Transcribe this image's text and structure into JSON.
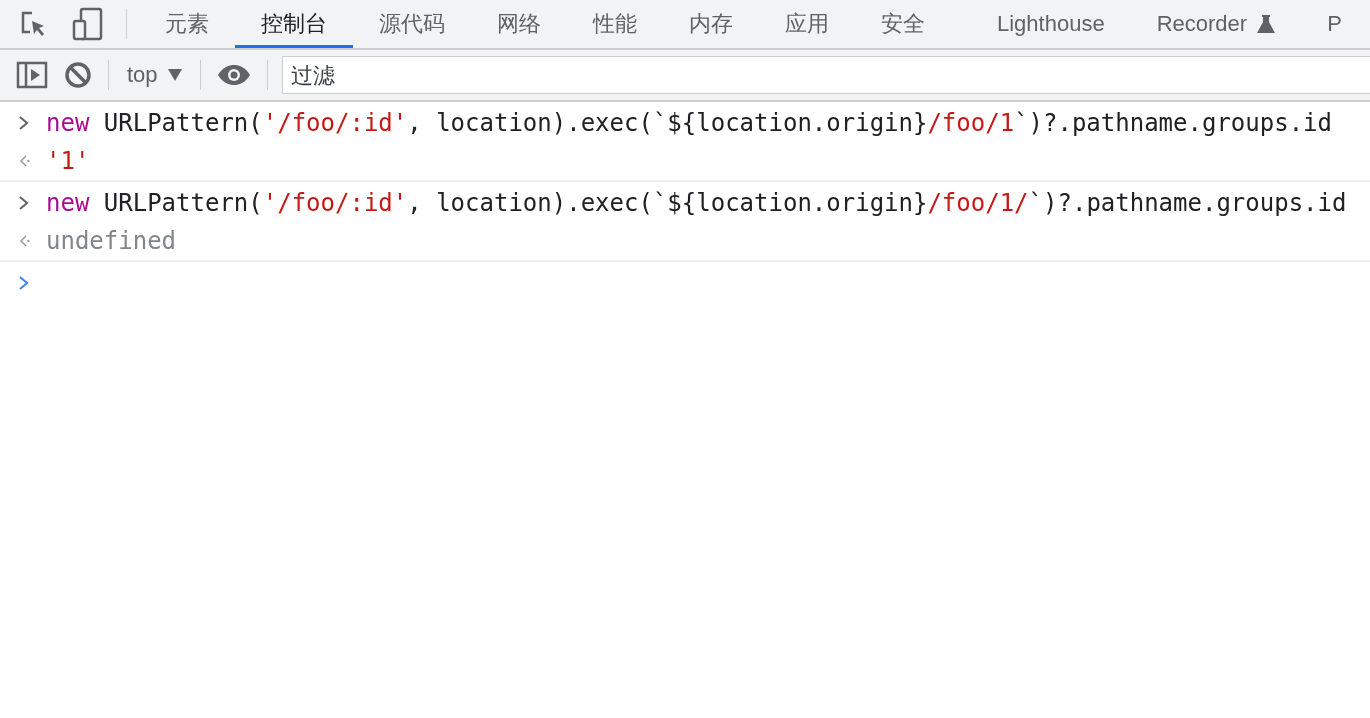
{
  "tabs": [
    {
      "label": "元素",
      "selected": false
    },
    {
      "label": "控制台",
      "selected": true
    },
    {
      "label": "源代码",
      "selected": false
    },
    {
      "label": "网络",
      "selected": false
    },
    {
      "label": "性能",
      "selected": false
    },
    {
      "label": "内存",
      "selected": false
    },
    {
      "label": "应用",
      "selected": false
    },
    {
      "label": "安全",
      "selected": false
    },
    {
      "label": "Lighthouse",
      "selected": false
    },
    {
      "label": "Recorder",
      "selected": false,
      "experimental": true
    },
    {
      "label": "P",
      "selected": false
    }
  ],
  "toolbar": {
    "context": "top",
    "filter": {
      "placeholder": "过滤"
    }
  },
  "console": [
    {
      "kind": "input",
      "tokens": [
        {
          "kind": "keyword",
          "text": "new"
        },
        {
          "kind": "plain",
          "text": " URLPattern("
        },
        {
          "kind": "string",
          "text": "'/foo/:id'"
        },
        {
          "kind": "plain",
          "text": ", location).exec(`${location.origin}"
        },
        {
          "kind": "string",
          "text": "/foo/1"
        },
        {
          "kind": "plain",
          "text": "`)?.pathname.groups.id"
        }
      ]
    },
    {
      "kind": "result",
      "tokens": [
        {
          "kind": "string",
          "text": "'1'"
        }
      ]
    },
    {
      "kind": "input",
      "tokens": [
        {
          "kind": "keyword",
          "text": "new"
        },
        {
          "kind": "plain",
          "text": " URLPattern("
        },
        {
          "kind": "string",
          "text": "'/foo/:id'"
        },
        {
          "kind": "plain",
          "text": ", location).exec(`${location.origin}"
        },
        {
          "kind": "string",
          "text": "/foo/1/"
        },
        {
          "kind": "plain",
          "text": "`)?.pathname.groups.id"
        }
      ]
    },
    {
      "kind": "result",
      "tokens": [
        {
          "kind": "undefined",
          "text": "undefined"
        }
      ]
    },
    {
      "kind": "prompt"
    }
  ]
}
